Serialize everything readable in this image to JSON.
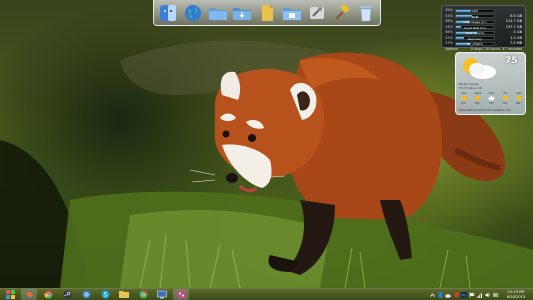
{
  "desktop": {
    "wallpaper_subject": "red-panda"
  },
  "dock": {
    "items": [
      {
        "name": "finder-icon"
      },
      {
        "name": "globe-icon"
      },
      {
        "name": "folder-icon"
      },
      {
        "name": "downloads-folder-icon"
      },
      {
        "name": "document-icon"
      },
      {
        "name": "photos-folder-icon"
      },
      {
        "name": "tools-icon"
      },
      {
        "name": "hammer-icon"
      },
      {
        "name": "recycle-bin-icon"
      }
    ]
  },
  "system_monitor": {
    "rows": [
      {
        "label": "39%",
        "bar_text": "CPU",
        "value": "",
        "fill": 0.39
      },
      {
        "label": "41%",
        "bar_text": "RAM",
        "value": "6.5 GB",
        "fill": 0.41
      },
      {
        "label": "38%",
        "bar_text": "Disk Usage (C:)",
        "value": "111.7 GB",
        "fill": 0.38
      },
      {
        "label": "14%",
        "bar_text": "Local Disk (D:)",
        "value": "137.7 GB",
        "fill": 0.14
      },
      {
        "label": "56%",
        "bar_text": "New Volume",
        "value": "0 GB",
        "fill": 0.56
      },
      {
        "label": "22%",
        "bar_text": "Recovery",
        "value": "1.0 GB",
        "fill": 0.22
      },
      {
        "label": "37%",
        "bar_text": "HP_TOOLS",
        "value": "7.5 MB",
        "fill": 0.37
      }
    ],
    "uptime_label": "Uptime",
    "uptime_value": "0 days, 18 hours, 47 minutes"
  },
  "weather": {
    "temperature": "75°",
    "condition": "Partly Cloudy",
    "location": "Fort Collins, CO",
    "forecast": [
      {
        "day": "Tue",
        "temp": "81°",
        "icon": "sun-icon"
      },
      {
        "day": "Wed",
        "temp": "83°",
        "icon": "sun-icon"
      },
      {
        "day": "Thu",
        "temp": "76°",
        "icon": "cloud-icon"
      },
      {
        "day": "Fri",
        "temp": "78°",
        "icon": "sun-icon"
      },
      {
        "day": "Sat",
        "temp": "80°",
        "icon": "sun-icon"
      }
    ],
    "footer": "Extended forecast from weather.com"
  },
  "taskbar": {
    "apps": [
      {
        "name": "start-icon",
        "color": "#6b4fa3"
      },
      {
        "name": "firefox-icon",
        "color": "#e86a1f"
      },
      {
        "name": "chrome-icon",
        "color": "#3b8fd6"
      },
      {
        "name": "steam-icon",
        "color": "#2a3a4a"
      },
      {
        "name": "outlook-icon",
        "color": "#2f84d0"
      },
      {
        "name": "skype-icon",
        "color": "#19a5e0"
      },
      {
        "name": "explorer-icon",
        "color": "#e7c35a"
      },
      {
        "name": "chrome-browser-icon",
        "color": "#4caf50"
      },
      {
        "name": "screen-icon",
        "color": "#3f6fb8"
      },
      {
        "name": "paint-icon",
        "color": "#c04d8f"
      }
    ],
    "tray": [
      "network-icon",
      "volume-icon",
      "photoshop-icon",
      "battery-icon",
      "flag-icon",
      "antivirus-icon",
      "cloud-sync-icon",
      "bluetooth-icon",
      "chevron-up-icon"
    ],
    "clock_time": "12:15 PM",
    "clock_date": "8/30/2013"
  }
}
